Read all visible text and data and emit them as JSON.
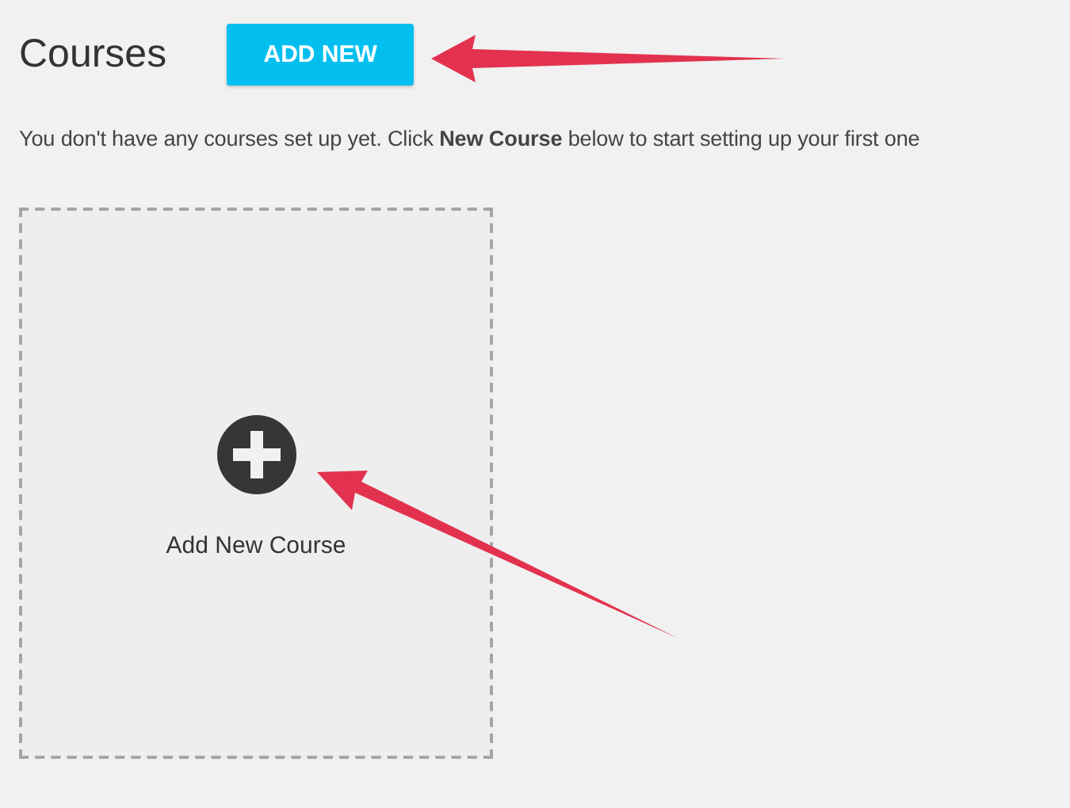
{
  "header": {
    "title": "Courses",
    "add_button": "ADD NEW"
  },
  "intro": "You don't have any courses set up yet. Click **New Course** below to start setting up your first one",
  "new_course_card": {
    "label": "Add New Course"
  }
}
